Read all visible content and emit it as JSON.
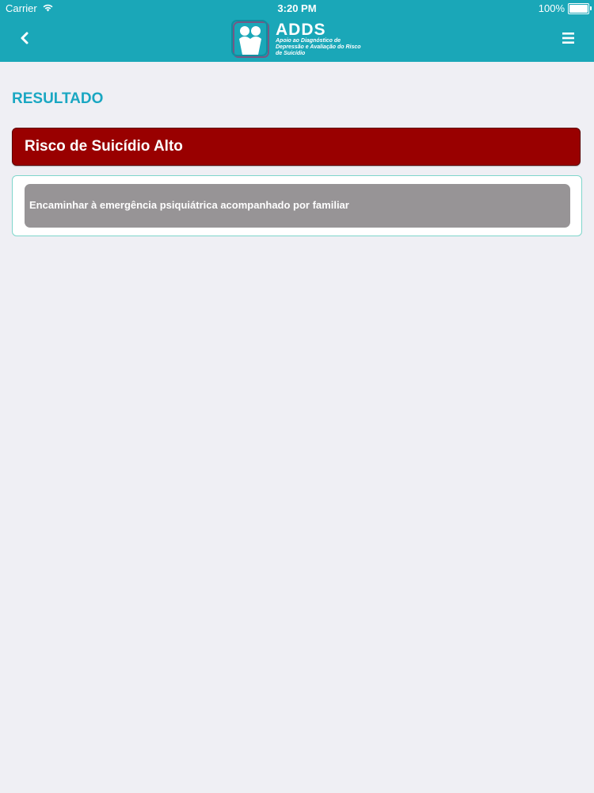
{
  "status_bar": {
    "carrier": "Carrier",
    "time": "3:20 PM",
    "battery": "100%"
  },
  "app": {
    "name": "ADDS",
    "subtitle": "Apoio ao Diagnóstico de Depressão e Avaliação do Risco de Suicídio"
  },
  "page": {
    "title": "RESULTADO"
  },
  "result": {
    "risk_label": "Risco de Suicídio Alto",
    "recommendation": "Encaminhar à emergência psiquiátrica acompanhado por familiar"
  },
  "icons": {
    "back": "chevron-left-icon",
    "menu": "hamburger-menu-icon",
    "wifi": "wifi-icon",
    "battery": "battery-icon"
  },
  "colors": {
    "header": "#1aa7b8",
    "title": "#1aa7c2",
    "risk_high": "#990000",
    "recommendation_bg": "#979496",
    "card_border": "#7fd6cb",
    "background": "#efeff4"
  }
}
